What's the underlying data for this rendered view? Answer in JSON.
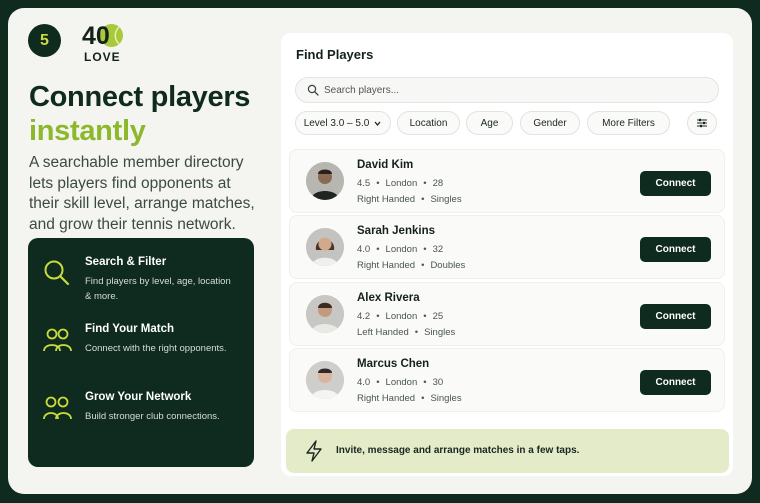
{
  "step": "5",
  "logo": {
    "number": "40",
    "word": "LOVE"
  },
  "headline": {
    "line1": "Connect players",
    "line2": "instantly"
  },
  "description": "A searchable member directory lets players find opponents at their skill level, arrange matches, and grow their tennis network.",
  "features": [
    {
      "title": "Search & Filter",
      "subtitle": "Find players by level, age, location & more.",
      "icon": "search-icon"
    },
    {
      "title": "Find Your Match",
      "subtitle": "Connect with the right opponents.",
      "icon": "users-icon"
    },
    {
      "title": "Grow Your Network",
      "subtitle": "Build stronger club connections.",
      "icon": "network-icon"
    }
  ],
  "panel": {
    "title": "Find Players",
    "search_placeholder": "Search players...",
    "filters": {
      "level": "Level 3.0 – 5.0",
      "location": "Location",
      "age": "Age",
      "gender": "Gender",
      "more": "More Filters"
    },
    "connect_label": "Connect",
    "players": [
      {
        "name": "David Kim",
        "rating": "4.5",
        "city": "London",
        "age": "28",
        "hand": "Right Handed",
        "format": "Singles"
      },
      {
        "name": "Sarah Jenkins",
        "rating": "4.0",
        "city": "London",
        "age": "32",
        "hand": "Right Handed",
        "format": "Doubles"
      },
      {
        "name": "Alex Rivera",
        "rating": "4.2",
        "city": "London",
        "age": "25",
        "hand": "Left Handed",
        "format": "Singles"
      },
      {
        "name": "Marcus Chen",
        "rating": "4.0",
        "city": "London",
        "age": "30",
        "hand": "Right Handed",
        "format": "Singles"
      }
    ]
  },
  "banner": {
    "text": "Invite, message and arrange matches in a few taps.",
    "icon": "bolt-icon"
  },
  "colors": {
    "brand_dark": "#0f2a1e",
    "accent_green": "#8cb82b",
    "banner_bg": "#e3ebc8"
  }
}
